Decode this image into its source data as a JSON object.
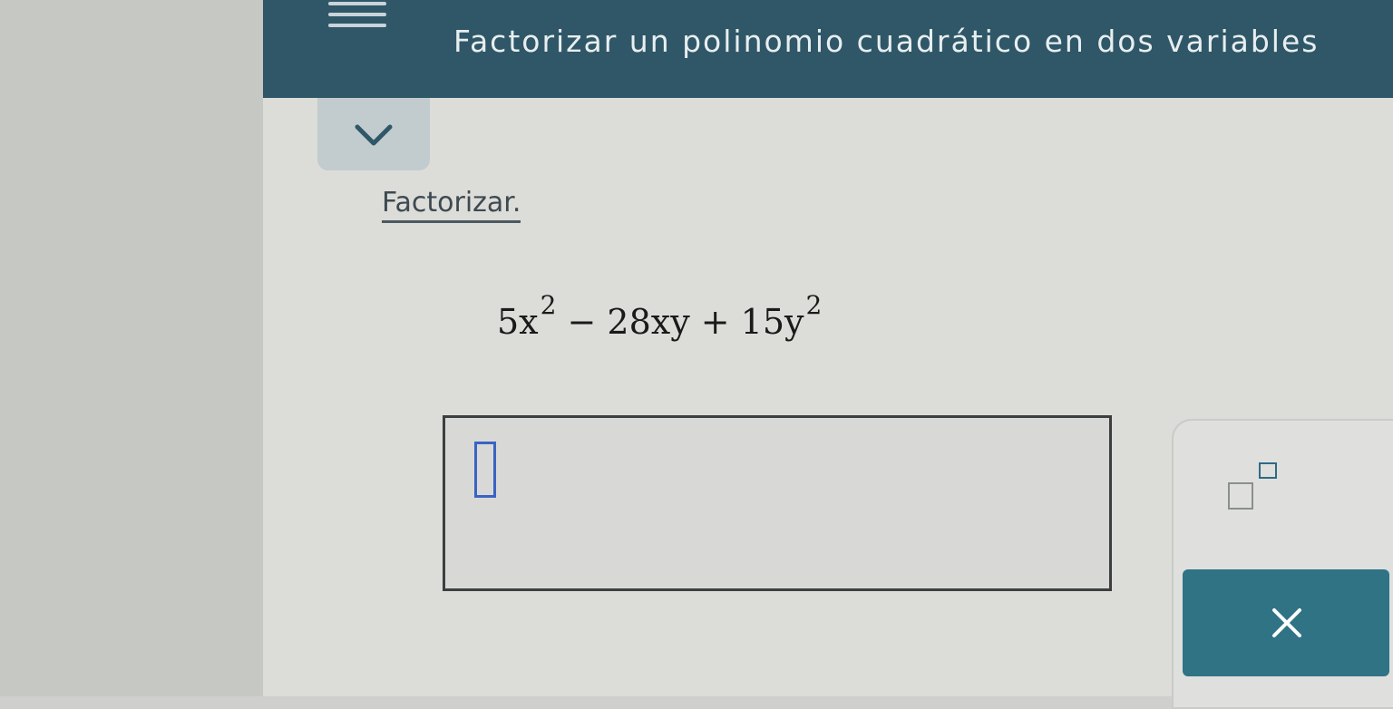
{
  "header": {
    "title": "Factorizar un polinomio cuadrático en dos variables",
    "background_color": "#2f5767"
  },
  "instruction": "Factorizar.",
  "expression": {
    "t1": "5x",
    "t1_exp": "2",
    "t2": " − 28xy + 15y",
    "t2_exp": "2"
  },
  "answer": {
    "value": ""
  },
  "keypad": {
    "exponent_button": "exponent-template-icon",
    "clear_button": "close-icon",
    "accent_color": "#2f7385"
  }
}
